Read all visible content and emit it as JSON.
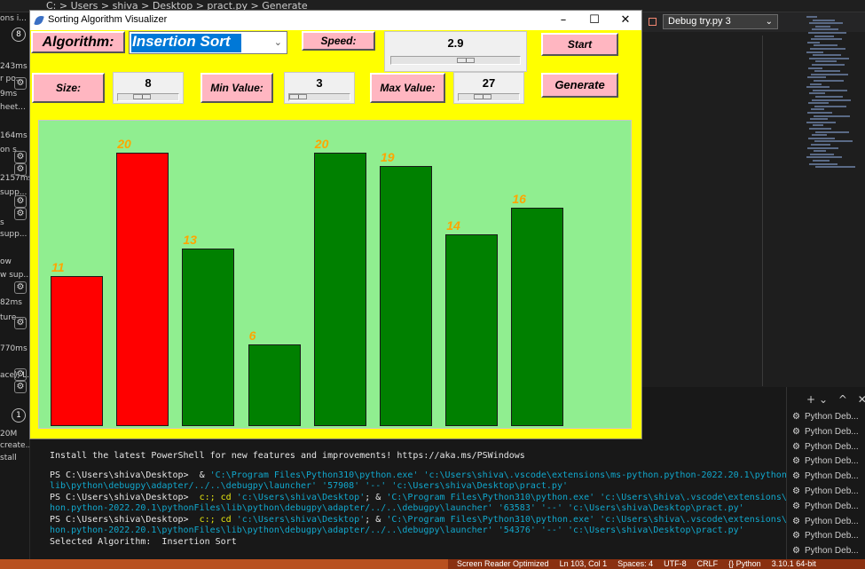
{
  "vscode": {
    "breadcrumb": "C: > Users > shiva > Desktop > pract.py > Generate",
    "debug_config": "Debug try.py 3",
    "left_panel": {
      "badge_top": "8",
      "badge_bottom": "1",
      "items": [
        "ons i...",
        "243ms",
        "r po...",
        "9ms",
        "heet...",
        "164ms",
        "on s...",
        "2157ms",
        "supp...",
        "s",
        "supp...",
        "ow",
        "w sup...",
        "82ms",
        "ture-...",
        "770ms",
        "ace), L...",
        "20M",
        "create...",
        "stall"
      ]
    },
    "terminal_lines": [
      {
        "segments": [
          {
            "text": "Install the latest PowerShell for new features and improvements! https://aka.ms/PSWindows",
            "color": "white"
          }
        ]
      },
      {
        "segments": [
          {
            "text": "",
            "color": "white"
          }
        ]
      },
      {
        "segments": [
          {
            "text": "PS C:\\Users\\shiva\\Desktop>  & ",
            "color": "white"
          },
          {
            "text": "'C:\\Program Files\\Python310\\python.exe' 'c:\\Users\\shiva\\.vscode\\extensions\\ms-python.python-2022.20.1\\pythonFiles\\",
            "color": "cyan"
          }
        ]
      },
      {
        "segments": [
          {
            "text": "lib\\python\\debugpy\\adapter/../..\\debugpy\\launcher' '57908' '--' 'c:\\Users\\shiva\\Desktop\\pract.py'",
            "color": "cyan"
          }
        ]
      },
      {
        "segments": [
          {
            "text": "PS C:\\Users\\shiva\\Desktop>  ",
            "color": "white"
          },
          {
            "text": "c:; cd ",
            "color": "yellow"
          },
          {
            "text": "'c:\\Users\\shiva\\Desktop'",
            "color": "cyan"
          },
          {
            "text": "; & ",
            "color": "white"
          },
          {
            "text": "'C:\\Program Files\\Python310\\python.exe' 'c:\\Users\\shiva\\.vscode\\extensions\\ms-pyt",
            "color": "cyan"
          }
        ]
      },
      {
        "segments": [
          {
            "text": "hon.python-2022.20.1\\pythonFiles\\lib\\python\\debugpy\\adapter/../..\\debugpy\\launcher' '63583' '--' 'c:\\Users\\shiva\\Desktop\\pract.py'",
            "color": "cyan"
          }
        ]
      },
      {
        "segments": [
          {
            "text": "PS C:\\Users\\shiva\\Desktop>  ",
            "color": "white"
          },
          {
            "text": "c:; cd ",
            "color": "yellow"
          },
          {
            "text": "'c:\\Users\\shiva\\Desktop'",
            "color": "cyan"
          },
          {
            "text": "; & ",
            "color": "white"
          },
          {
            "text": "'C:\\Program Files\\Python310\\python.exe' 'c:\\Users\\shiva\\.vscode\\extensions\\ms-pyt",
            "color": "cyan"
          }
        ]
      },
      {
        "segments": [
          {
            "text": "hon.python-2022.20.1\\pythonFiles\\lib\\python\\debugpy\\adapter/../..\\debugpy\\launcher' '54376' '--' 'c:\\Users\\shiva\\Desktop\\pract.py'",
            "color": "cyan"
          }
        ]
      },
      {
        "segments": [
          {
            "text": "Selected Algorithm:  Insertion Sort",
            "color": "white"
          }
        ]
      }
    ],
    "terminal_tabs": [
      "Python Deb...",
      "Python Deb...",
      "Python Deb...",
      "Python Deb...",
      "Python Deb...",
      "Python Deb...",
      "Python Deb...",
      "Python Deb...",
      "Python Deb...",
      "Python Deb..."
    ],
    "status_items": [
      "Screen Reader Optimized",
      "Ln 103, Col 1",
      "Spaces: 4",
      "UTF-8",
      "CRLF",
      "{} Python",
      "3.10.1 64-bit"
    ]
  },
  "app": {
    "title": "Sorting Algorithm Visualizer",
    "algorithm_label": "Algorithm:",
    "algorithm_value": "Insertion Sort",
    "speed_label": "Speed:",
    "speed_value": "2.9",
    "start_label": "Start",
    "size_label": "Size:",
    "size_value": "8",
    "min_label": "Min Value:",
    "min_value": "3",
    "max_label": "Max Value:",
    "max_value": "27",
    "generate_label": "Generate",
    "bars": [
      {
        "value": "11",
        "color": "#ff0000"
      },
      {
        "value": "20",
        "color": "#ff0000"
      },
      {
        "value": "13",
        "color": "#008000"
      },
      {
        "value": "6",
        "color": "#008000"
      },
      {
        "value": "20",
        "color": "#008000"
      },
      {
        "value": "19",
        "color": "#008000"
      },
      {
        "value": "14",
        "color": "#008000"
      },
      {
        "value": "16",
        "color": "#008000"
      }
    ]
  }
}
